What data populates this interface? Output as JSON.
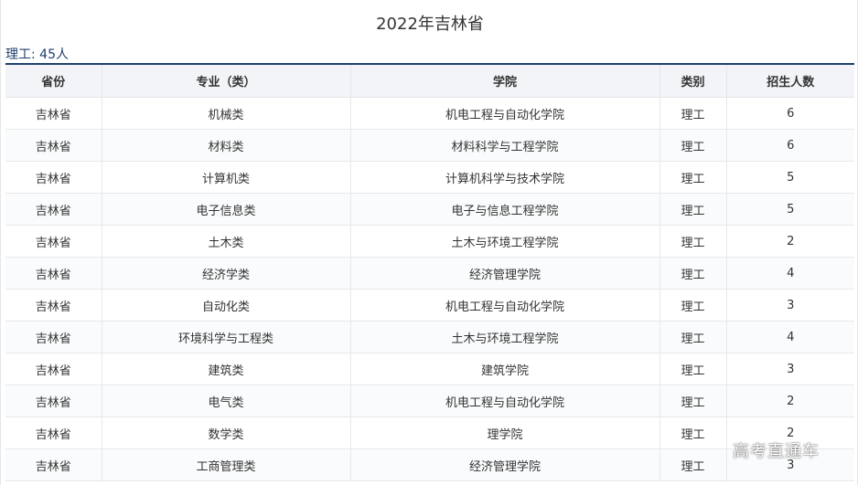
{
  "page": {
    "title": "2022年吉林省",
    "summary_label": "理工:",
    "summary_count": "45人"
  },
  "table": {
    "headers": [
      "省份",
      "专业（类）",
      "学院",
      "类别",
      "招生人数"
    ],
    "rows": [
      [
        "吉林省",
        "机械类",
        "机电工程与自动化学院",
        "理工",
        "6"
      ],
      [
        "吉林省",
        "材料类",
        "材料科学与工程学院",
        "理工",
        "6"
      ],
      [
        "吉林省",
        "计算机类",
        "计算机科学与技术学院",
        "理工",
        "5"
      ],
      [
        "吉林省",
        "电子信息类",
        "电子与信息工程学院",
        "理工",
        "5"
      ],
      [
        "吉林省",
        "土木类",
        "土木与环境工程学院",
        "理工",
        "2"
      ],
      [
        "吉林省",
        "经济学类",
        "经济管理学院",
        "理工",
        "4"
      ],
      [
        "吉林省",
        "自动化类",
        "机电工程与自动化学院",
        "理工",
        "3"
      ],
      [
        "吉林省",
        "环境科学与工程类",
        "土木与环境工程学院",
        "理工",
        "4"
      ],
      [
        "吉林省",
        "建筑类",
        "建筑学院",
        "理工",
        "3"
      ],
      [
        "吉林省",
        "电气类",
        "机电工程与自动化学院",
        "理工",
        "2"
      ],
      [
        "吉林省",
        "数学类",
        "理学院",
        "理工",
        "2"
      ],
      [
        "吉林省",
        "工商管理类",
        "经济管理学院",
        "理工",
        "3"
      ]
    ]
  },
  "watermark": {
    "text": "高考直通车"
  }
}
